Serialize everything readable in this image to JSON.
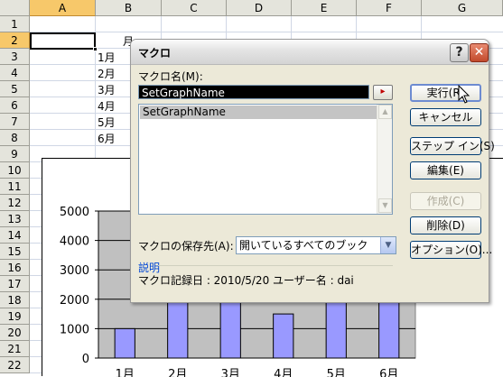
{
  "sheet": {
    "columns": [
      "A",
      "B",
      "C",
      "D",
      "E",
      "F",
      "G"
    ],
    "rows": [
      "1",
      "2",
      "3",
      "4",
      "5",
      "6",
      "7",
      "8",
      "9",
      "10",
      "11",
      "12",
      "13",
      "14",
      "15",
      "16",
      "17",
      "18",
      "19",
      "20",
      "21",
      "22"
    ],
    "cells": {
      "b2_partial": "月",
      "c2_partial": "ー ‑ 綾",
      "b3": "1月",
      "b4": "2月",
      "b5": "3月",
      "b6": "4月",
      "b7": "5月",
      "b8": "6月"
    }
  },
  "chart_data": {
    "type": "bar",
    "categories": [
      "1月",
      "2月",
      "3月",
      "4月",
      "5月",
      "6月"
    ],
    "values": [
      1000,
      2000,
      2000,
      1500,
      2000,
      2000
    ],
    "yticks": [
      "0",
      "1000",
      "2000",
      "3000",
      "4000",
      "5000"
    ],
    "ylim": [
      0,
      5000
    ],
    "bar_color": "#9999ff",
    "plot_bg": "#c0c0c0"
  },
  "dialog": {
    "title": "マクロ",
    "help_label": "?",
    "close_label": "✕",
    "macro_name_label": "マクロ名(M):",
    "macro_name_value": "SetGraphName",
    "pick_label": "▸",
    "list_items": [
      "SetGraphName"
    ],
    "buttons": {
      "run": "実行(R)",
      "cancel": "キャンセル",
      "step_in": "ステップ イン(S)",
      "edit": "編集(E)",
      "create": "作成(C)",
      "delete": "削除(D)",
      "options": "オプション(O)..."
    },
    "store_label": "マクロの保存先(A):",
    "store_value": "開いているすべてのブック",
    "desc_label": "説明",
    "desc_text": "マクロ記録日 : 2010/5/20  ユーザー名 : dai"
  }
}
